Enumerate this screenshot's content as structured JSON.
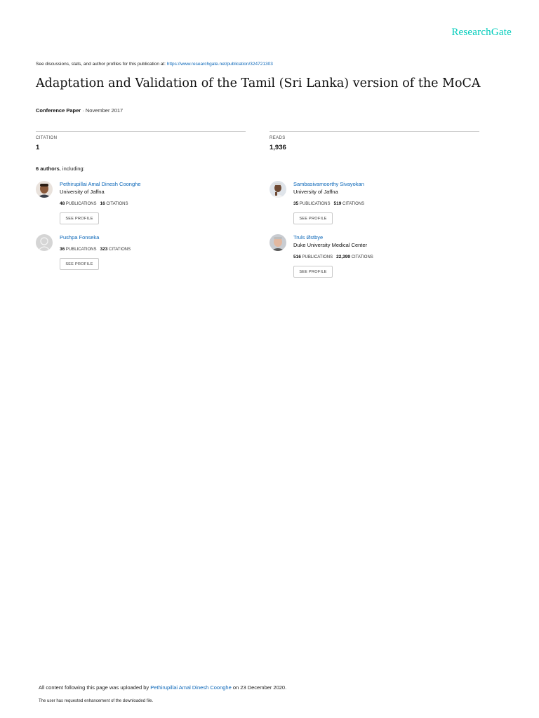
{
  "brand": "ResearchGate",
  "discussion": {
    "prefix": "See discussions, stats, and author profiles for this publication at: ",
    "url": "https://www.researchgate.net/publication/324721303"
  },
  "title": "Adaptation and Validation of the Tamil (Sri Lanka) version of the MoCA",
  "meta": {
    "type": "Conference Paper",
    "date": " · November 2017"
  },
  "stats": {
    "citation_label": "CITATION",
    "citation_value": "1",
    "reads_label": "READS",
    "reads_value": "1,936"
  },
  "authors_heading": {
    "count": "6 authors",
    "suffix": ", including:"
  },
  "authors": [
    {
      "name": "Pethirupillai Amal Dinesh Coonghe",
      "affiliation": "University of Jaffna",
      "publications": "48",
      "publications_label": "PUBLICATIONS",
      "citations": "16",
      "citations_label": "CITATIONS",
      "button": "SEE PROFILE"
    },
    {
      "name": "Sambasivamoorthy Sivayokan",
      "affiliation": "University of Jaffna",
      "publications": "35",
      "publications_label": "PUBLICATIONS",
      "citations": "519",
      "citations_label": "CITATIONS",
      "button": "SEE PROFILE"
    },
    {
      "name": "Pushpa Fonseka",
      "affiliation": "",
      "publications": "36",
      "publications_label": "PUBLICATIONS",
      "citations": "323",
      "citations_label": "CITATIONS",
      "button": "SEE PROFILE"
    },
    {
      "name": "Truls Østbye",
      "affiliation": "Duke University Medical Center",
      "publications": "516",
      "publications_label": "PUBLICATIONS",
      "citations": "22,399",
      "citations_label": "CITATIONS",
      "button": "SEE PROFILE"
    }
  ],
  "footer": {
    "uploaded_prefix": "All content following this page was uploaded by ",
    "uploader": "Pethirupillai Amal Dinesh Coonghe",
    "uploaded_suffix": " on 23 December 2020.",
    "note": "The user has requested enhancement of the downloaded file."
  }
}
